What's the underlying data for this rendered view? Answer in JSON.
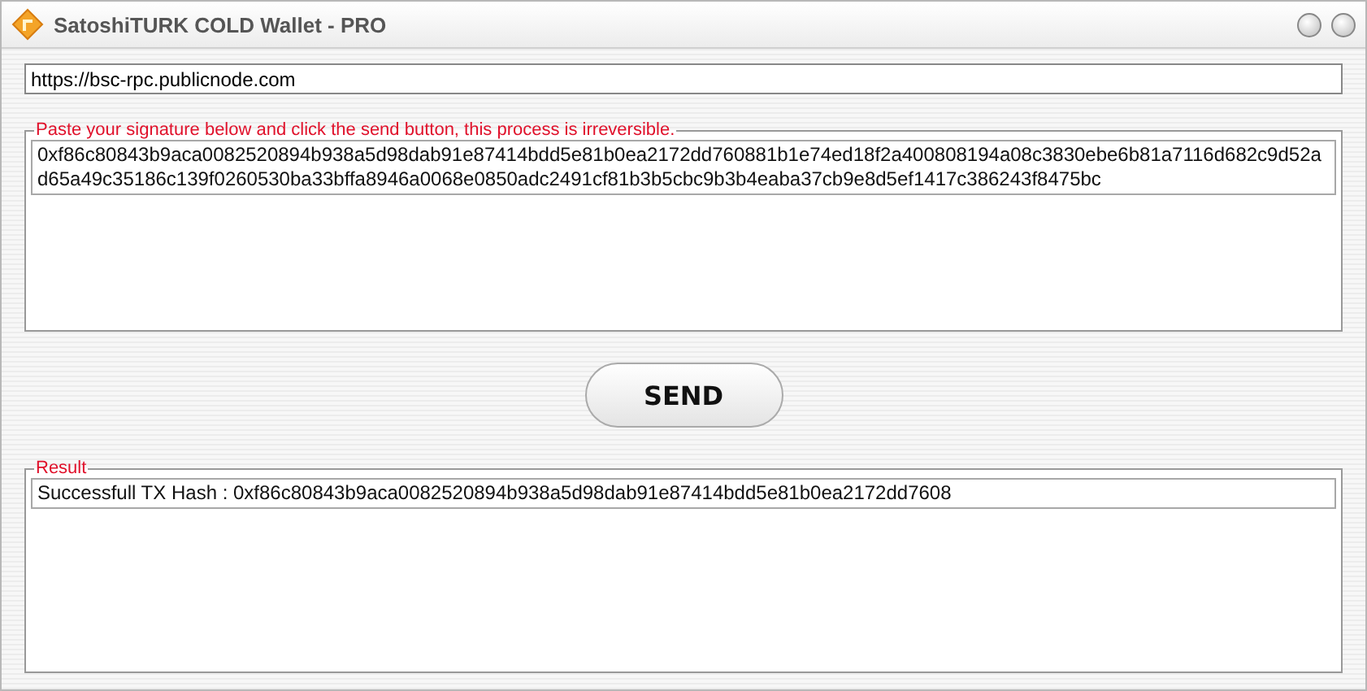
{
  "window": {
    "title": "SatoshiTURK COLD Wallet - PRO"
  },
  "rpc_field": {
    "value": "https://bsc-rpc.publicnode.com"
  },
  "signature": {
    "label": "Paste your signature below and click the send button, this process is irreversible.",
    "value": "0xf86c80843b9aca0082520894b938a5d98dab91e87414bdd5e81b0ea2172dd760881b1e74ed18f2a400808194a08c3830ebe6b81a7116d682c9d52ad65a49c35186c139f0260530ba33bffa8946a0068e0850adc2491cf81b3b5cbc9b3b4eaba37cb9e8d5ef1417c386243f8475bc"
  },
  "send_button": {
    "label": "SEND"
  },
  "result": {
    "label": "Result",
    "text": "Successfull TX Hash : 0xf86c80843b9aca0082520894b938a5d98dab91e87414bdd5e81b0ea2172dd7608"
  }
}
